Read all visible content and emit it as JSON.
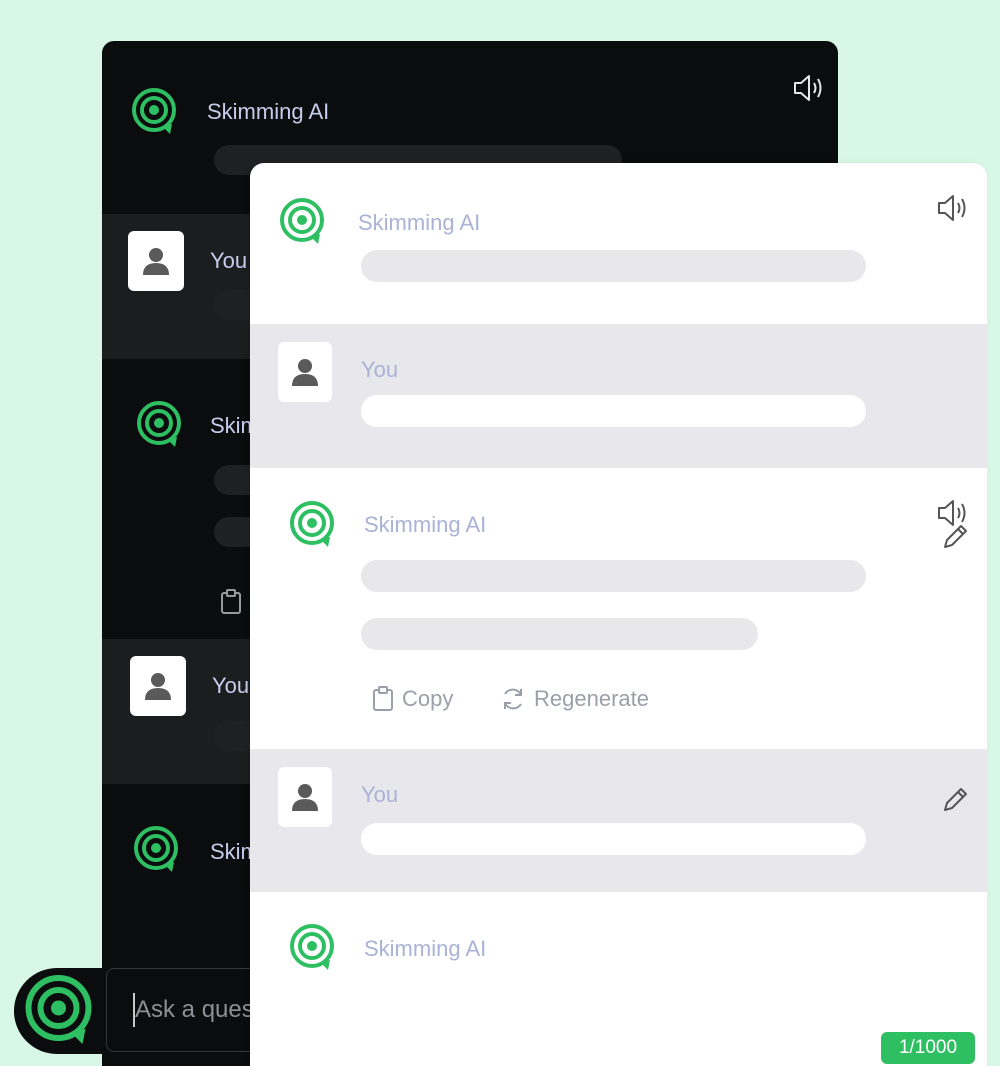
{
  "colors": {
    "brand_green": "#2fbf63",
    "page_bg": "#d9f7e6"
  },
  "icons": {
    "logo": "target-chat-icon",
    "speaker": "speaker-icon",
    "user": "user-icon",
    "edit": "pencil-icon",
    "copy": "clipboard-icon",
    "regenerate": "refresh-icon"
  },
  "back_panel": {
    "messages": [
      {
        "role": "assistant",
        "name": "Skimming AI"
      },
      {
        "role": "user",
        "name": "You"
      },
      {
        "role": "assistant",
        "name": "Skim"
      },
      {
        "role": "user",
        "name": "You"
      },
      {
        "role": "assistant",
        "name": "Skim"
      }
    ]
  },
  "front_panel": {
    "messages": [
      {
        "role": "assistant",
        "name": "Skimming AI"
      },
      {
        "role": "user",
        "name": "You"
      },
      {
        "role": "assistant",
        "name": "Skimming AI"
      },
      {
        "role": "user",
        "name": "You"
      },
      {
        "role": "assistant",
        "name": "Skimming AI"
      }
    ],
    "actions": {
      "copy": "Copy",
      "regenerate": "Regenerate"
    },
    "char_counter": "1/1000"
  },
  "composer": {
    "placeholder": "Ask a question..."
  }
}
